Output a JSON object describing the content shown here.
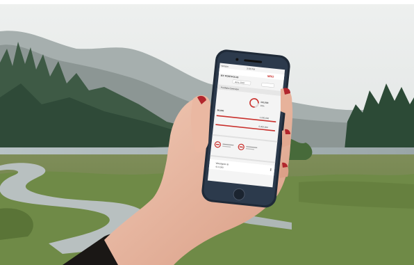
{
  "phone": {
    "carrier": "Verizon",
    "time": "3:03 PM",
    "brand": "MRO",
    "portfolio_title": "MY PORTFOLIO",
    "date_selector": "June 2019",
    "section_title": "Portfolio Overview",
    "summary_value": "110,000",
    "summary_percent": "15%",
    "value_a": "98,900",
    "value_b": "1,000,000",
    "value_c": "5,000,000",
    "row_label": "Woodgrain B",
    "row_value": "41.0,000"
  },
  "colors": {
    "accent": "#c9302c",
    "phone_body": "#1f2a38",
    "screen_bg": "#f4f4f4"
  }
}
